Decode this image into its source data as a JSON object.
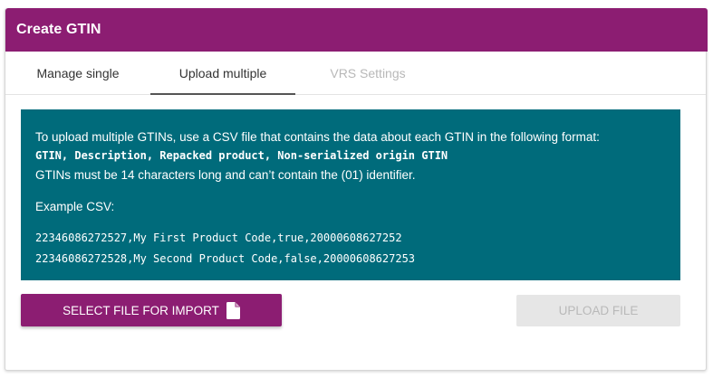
{
  "header": {
    "title": "Create GTIN"
  },
  "tabs": [
    {
      "label": "Manage single",
      "state": "normal"
    },
    {
      "label": "Upload multiple",
      "state": "active"
    },
    {
      "label": "VRS Settings",
      "state": "disabled"
    }
  ],
  "info": {
    "intro": "To upload multiple GTINs, use a CSV file that contains the data about each GTIN in the following format:",
    "format": "GTIN, Description, Repacked product, Non-serialized origin GTIN",
    "rule": "GTINs must be 14 characters long and can’t contain the (01) identifier.",
    "example_label": "Example CSV:",
    "csv_lines": [
      "22346086272527,My First Product Code,true,20000608627252",
      "22346086272528,My Second Product Code,false,20000608627253"
    ]
  },
  "buttons": {
    "select_file_label": "SELECT FILE FOR IMPORT",
    "select_file_icon": "file-icon",
    "upload_file_label": "UPLOAD FILE",
    "upload_file_state": "disabled"
  },
  "colors": {
    "brand": "#8c1d72",
    "info_background": "#006b7b",
    "disabled_button": "#e6e6e6",
    "disabled_text": "#b9b9b9"
  }
}
